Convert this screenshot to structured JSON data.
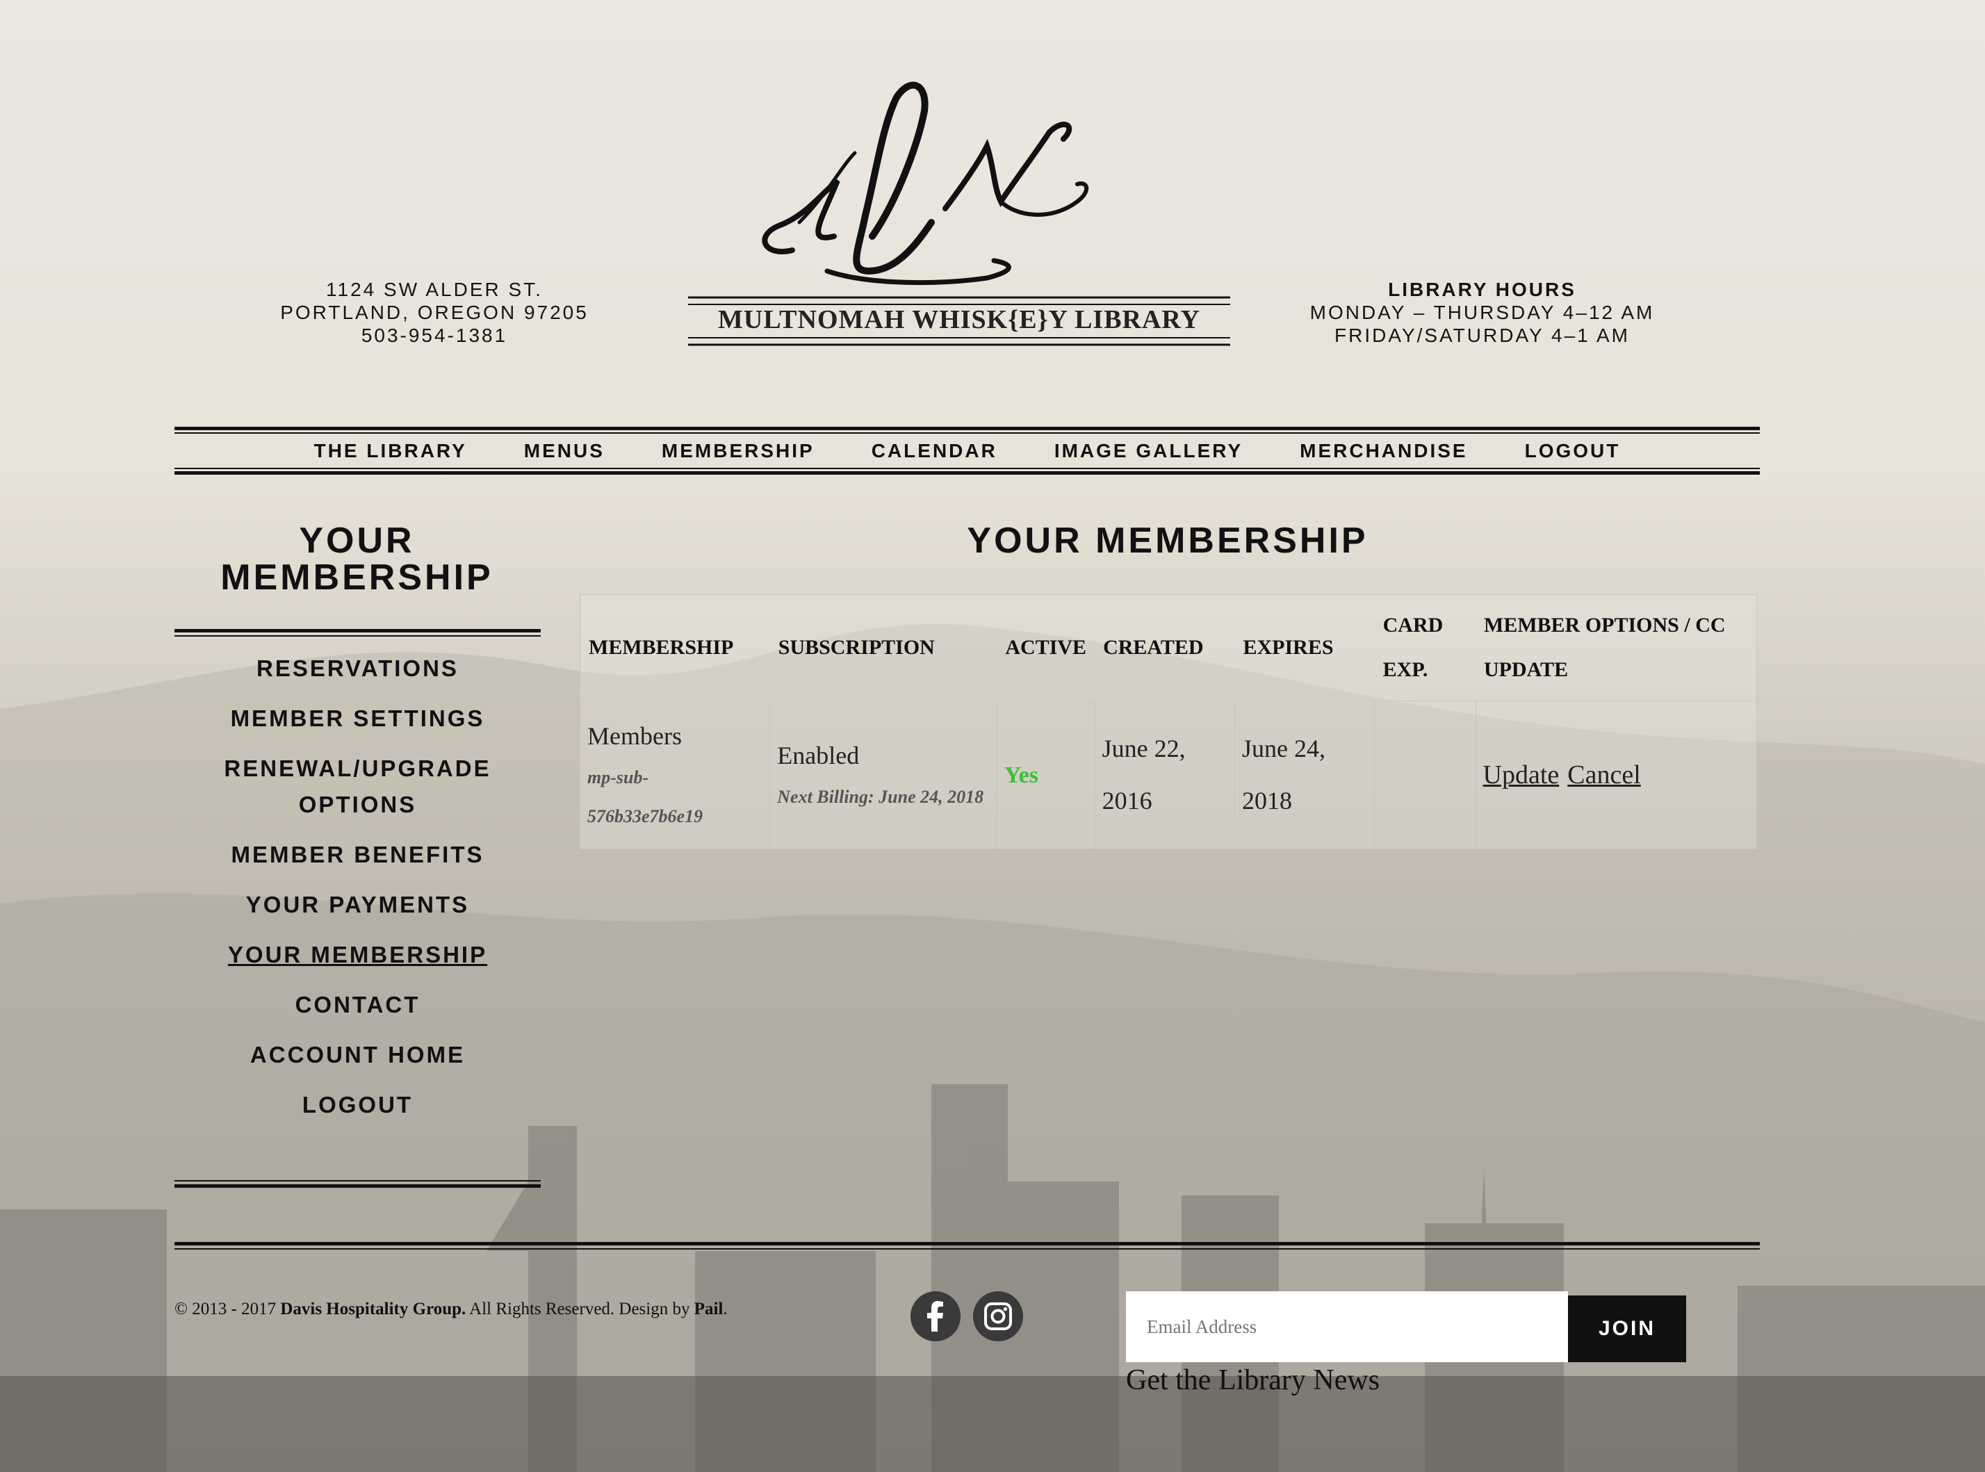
{
  "header": {
    "address": [
      "1124 SW ALDER ST.",
      "PORTLAND, OREGON 97205",
      "503-954-1381"
    ],
    "logo_text": "MULTNOMAH WHISK{E}Y LIBRARY",
    "hours": {
      "title": "LIBRARY HOURS",
      "lines": [
        "MONDAY – THURSDAY 4–12 AM",
        "FRIDAY/SATURDAY 4–1 AM"
      ]
    }
  },
  "nav": {
    "items": [
      "THE LIBRARY",
      "MENUS",
      "MEMBERSHIP",
      "CALENDAR",
      "IMAGE GALLERY",
      "MERCHANDISE",
      "LOGOUT"
    ]
  },
  "sidebar": {
    "title_line1": "YOUR",
    "title_line2": "MEMBERSHIP",
    "items": [
      "RESERVATIONS",
      "MEMBER SETTINGS",
      "RENEWAL/UPGRADE OPTIONS",
      "MEMBER BENEFITS",
      "YOUR PAYMENTS",
      "YOUR MEMBERSHIP",
      "CONTACT",
      "ACCOUNT HOME",
      "LOGOUT"
    ]
  },
  "main": {
    "title": "YOUR MEMBERSHIP",
    "columns": [
      "MEMBERSHIP",
      "SUBSCRIPTION",
      "ACTIVE",
      "CREATED",
      "EXPIRES",
      "CARD EXP.",
      "MEMBER OPTIONS / CC UPDATE"
    ],
    "row": {
      "membership": "Members",
      "membership_id": "mp-sub-576b33e7b6e19",
      "subscription": "Enabled",
      "next_billing": "Next Billing: June 24, 2018",
      "active": "Yes",
      "created": "June 22, 2016",
      "expires": "June 24, 2018",
      "card_exp": "",
      "update_label": "Update",
      "cancel_label": "Cancel"
    }
  },
  "footer": {
    "copyright_prefix": "© 2013 - 2017 ",
    "company": "Davis Hospitality Group.",
    "rights": " All Rights Reserved. Design by ",
    "designer": "Pail",
    "period": ".",
    "social": [
      "facebook-icon",
      "instagram-icon"
    ],
    "email_placeholder": "Email Address",
    "join_label": "JOIN",
    "news_label": "Get the Library News"
  },
  "colors": {
    "background": "#ebe7e0",
    "text": "#111111",
    "active_green": "#3bbf3b",
    "join_bg": "#111111"
  }
}
